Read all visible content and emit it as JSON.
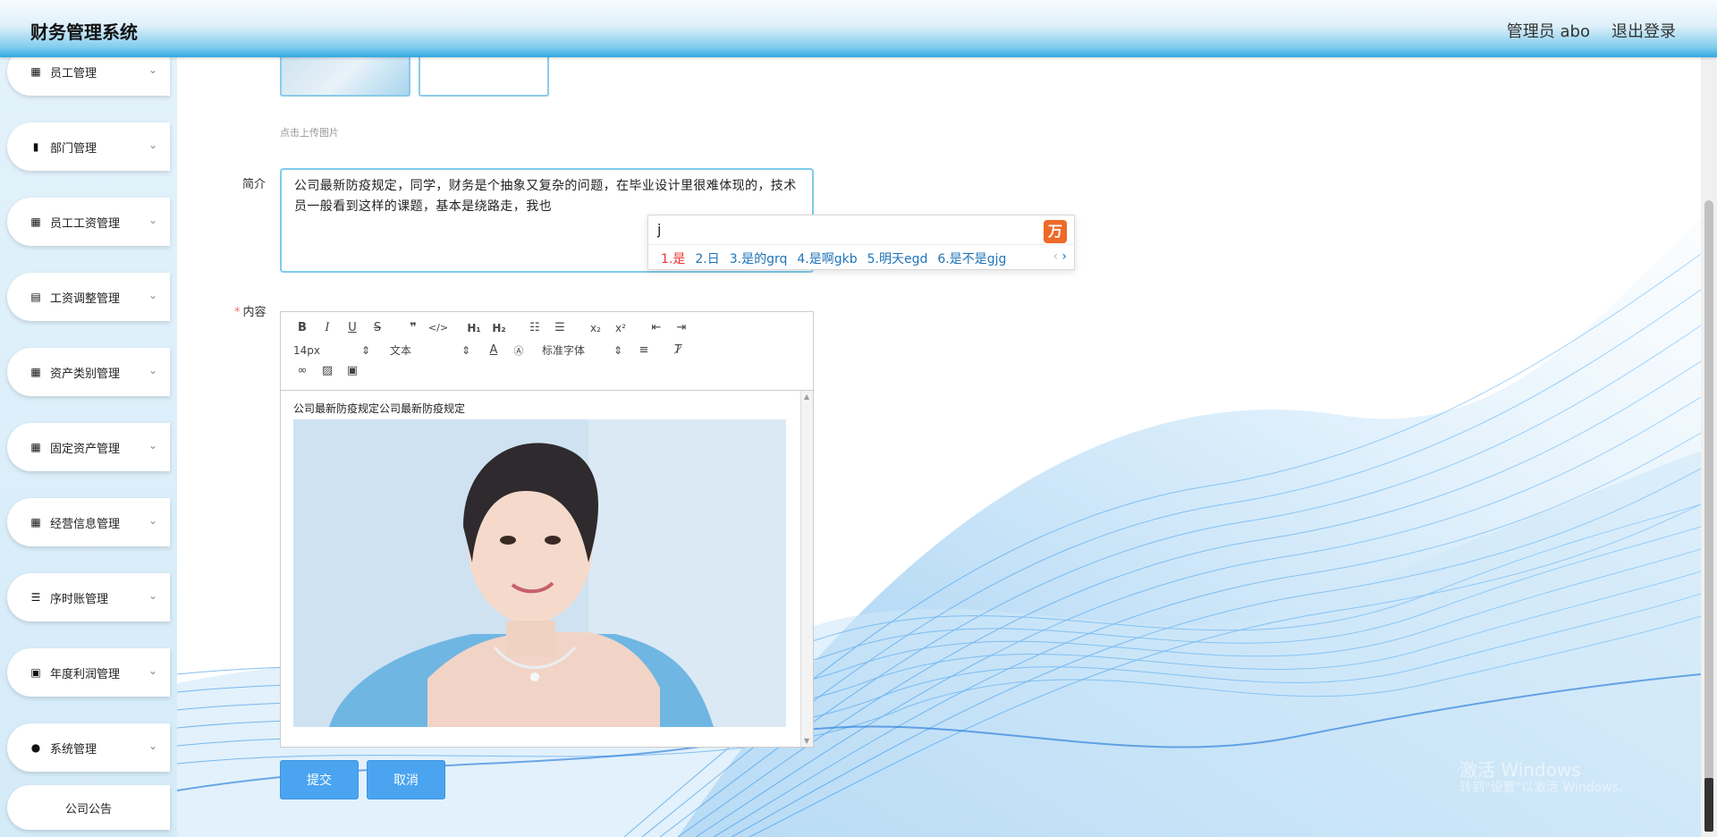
{
  "header": {
    "title": "财务管理系统",
    "user": "管理员 abo",
    "logout": "退出登录"
  },
  "sidebar": {
    "items": [
      {
        "label": "员工管理",
        "icon": "grid-icon"
      },
      {
        "label": "部门管理",
        "icon": "bar-chart-icon"
      },
      {
        "label": "员工工资管理",
        "icon": "grid-icon"
      },
      {
        "label": "工资调整管理",
        "icon": "clipboard-icon"
      },
      {
        "label": "资产类别管理",
        "icon": "grid-icon"
      },
      {
        "label": "固定资产管理",
        "icon": "grid-icon"
      },
      {
        "label": "经营信息管理",
        "icon": "grid-icon"
      },
      {
        "label": "序时账管理",
        "icon": "list-icon"
      },
      {
        "label": "年度利润管理",
        "icon": "clipboard-check-icon"
      },
      {
        "label": "系统管理",
        "icon": "user-icon"
      }
    ],
    "bottom_item": "公司公告"
  },
  "form": {
    "upload_hint": "点击上传图片",
    "intro_label": "简介",
    "intro_value": "公司最新防疫规定，同学，财务是个抽象又复杂的问题，在毕业设计里很难体现的，技术员一般看到这样的课题，基本是绕路走，我也",
    "content_label": "内容",
    "required_mark": "*",
    "editor": {
      "font_size": "14px",
      "paragraph": "文本",
      "font_family": "标准字体",
      "text": "公司最新防疫规定公司最新防疫规定"
    },
    "submit": "提交",
    "cancel": "取消"
  },
  "ime": {
    "input": "j",
    "candidates": [
      "1.是",
      "2.日",
      "3.是的grq",
      "4.是啊gkb",
      "5.明天egd",
      "6.是不是gjg"
    ]
  },
  "watermark": {
    "line1": "激活 Windows",
    "line2": "转到\"设置\"以激活 Windows。"
  },
  "colors": {
    "accent": "#4aa4f0",
    "header_bottom": "#31a9e2",
    "ime_first": "#ee3333"
  }
}
